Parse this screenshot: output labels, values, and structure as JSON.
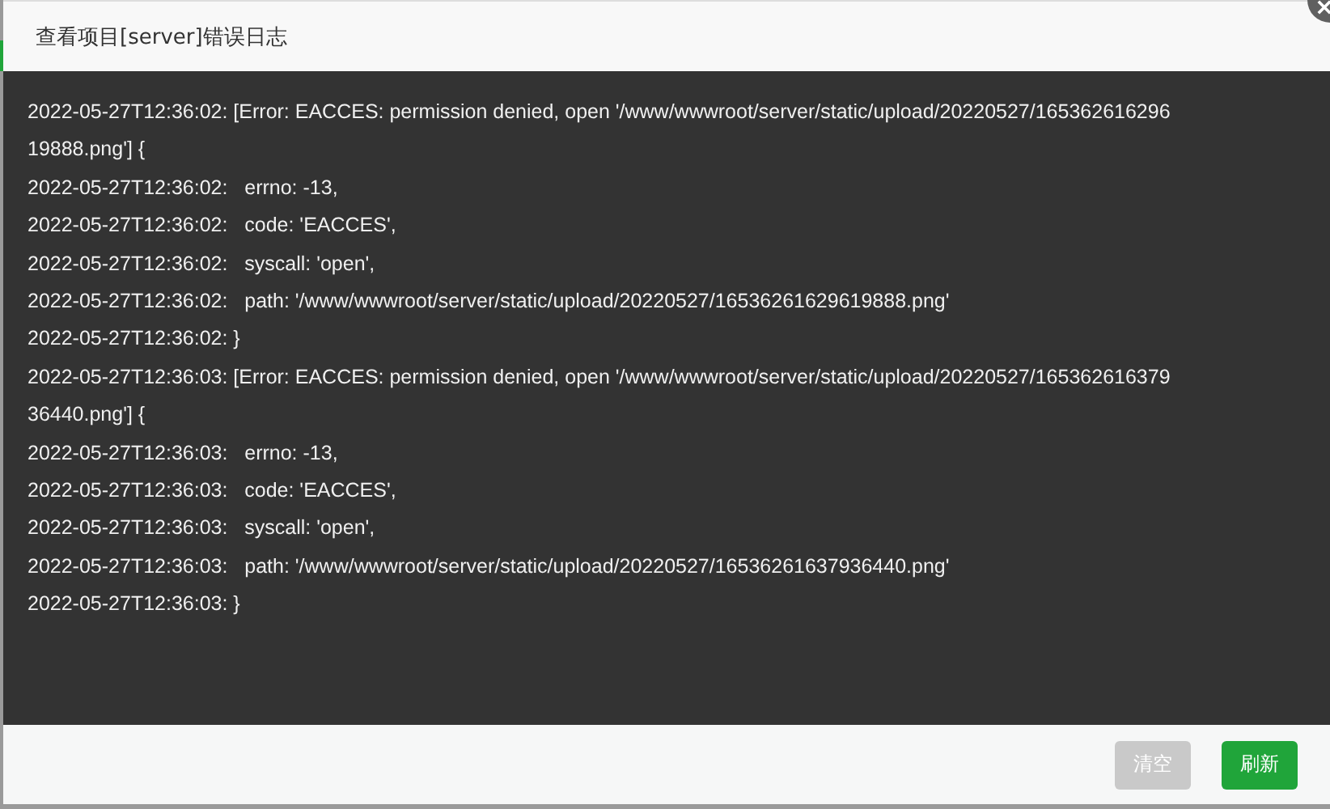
{
  "dialog": {
    "title": "查看项目[server]错误日志"
  },
  "log_lines": [
    "2022-05-27T12:36:02: [Error: EACCES: permission denied, open '/www/wwwroot/server/static/upload/20220527/165362616296",
    "19888.png'] {",
    "2022-05-27T12:36:02:   errno: -13,",
    "2022-05-27T12:36:02:   code: 'EACCES',",
    "2022-05-27T12:36:02:   syscall: 'open',",
    "2022-05-27T12:36:02:   path: '/www/wwwroot/server/static/upload/20220527/16536261629619888.png'",
    "2022-05-27T12:36:02: }",
    "2022-05-27T12:36:03: [Error: EACCES: permission denied, open '/www/wwwroot/server/static/upload/20220527/165362616379",
    "36440.png'] {",
    "2022-05-27T12:36:03:   errno: -13,",
    "2022-05-27T12:36:03:   code: 'EACCES',",
    "2022-05-27T12:36:03:   syscall: 'open',",
    "2022-05-27T12:36:03:   path: '/www/wwwroot/server/static/upload/20220527/16536261637936440.png'",
    "2022-05-27T12:36:03: }"
  ],
  "buttons": [
    {
      "label": "清空",
      "kind": "secondary",
      "disabled": true
    },
    {
      "label": "刷新",
      "kind": "primary",
      "disabled": false
    }
  ]
}
